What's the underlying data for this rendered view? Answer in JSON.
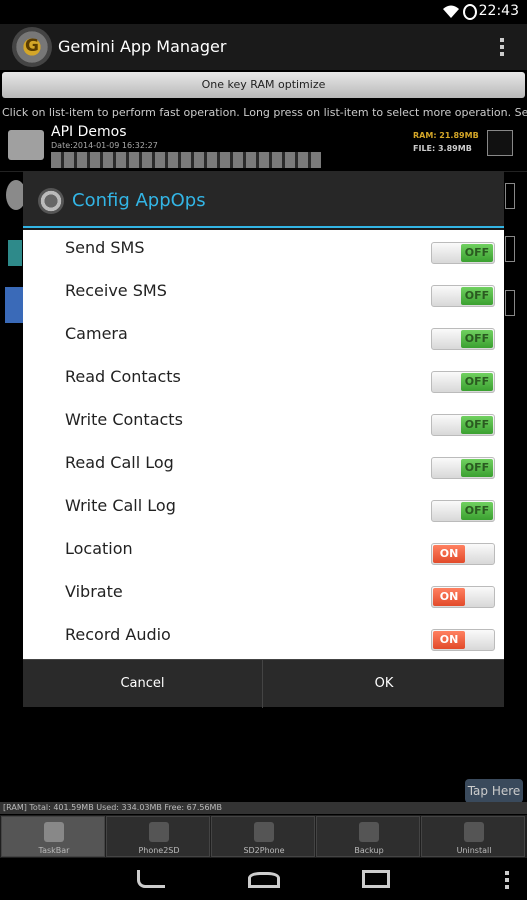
{
  "status_bar": {
    "time": "22:43"
  },
  "app": {
    "title": "Gemini App Manager",
    "icon_letter": "G"
  },
  "toolbar": {
    "ram_optimize_label": "One key RAM optimize",
    "hint": "Click on list-item to perform fast operation.   Long press on list-item to select more operation.   Select menu"
  },
  "list": [
    {
      "name": "API Demos",
      "date": "Date:2014-01-09 16:32:27",
      "ram": "RAM: 21.89MB",
      "file": "FILE: 3.89MB"
    }
  ],
  "dialog": {
    "title": "Config AppOps",
    "ops": [
      {
        "label": "Send SMS",
        "state": "OFF"
      },
      {
        "label": "Receive SMS",
        "state": "OFF"
      },
      {
        "label": "Camera",
        "state": "OFF"
      },
      {
        "label": "Read Contacts",
        "state": "OFF"
      },
      {
        "label": "Write Contacts",
        "state": "OFF"
      },
      {
        "label": "Read Call Log",
        "state": "OFF"
      },
      {
        "label": "Write Call Log",
        "state": "OFF"
      },
      {
        "label": "Location",
        "state": "ON"
      },
      {
        "label": "Vibrate",
        "state": "ON"
      },
      {
        "label": "Record Audio",
        "state": "ON"
      }
    ],
    "cancel_label": "Cancel",
    "ok_label": "OK"
  },
  "tap_here_label": "Tap Here",
  "ram_status": "[RAM] Total: 401.59MB Used: 334.03MB Free: 67.56MB",
  "tabs": [
    {
      "label": "TaskBar",
      "icon": "android-icon"
    },
    {
      "label": "Phone2SD",
      "icon": "phone-icon"
    },
    {
      "label": "SD2Phone",
      "icon": "sdcard-icon"
    },
    {
      "label": "Backup",
      "icon": "save-icon"
    },
    {
      "label": "Uninstall",
      "icon": "trash-icon"
    }
  ],
  "colors": {
    "accent": "#33b5e5",
    "switch_on": "#e24a2a",
    "switch_off": "#3aa030",
    "ram_text": "#d4a628"
  }
}
